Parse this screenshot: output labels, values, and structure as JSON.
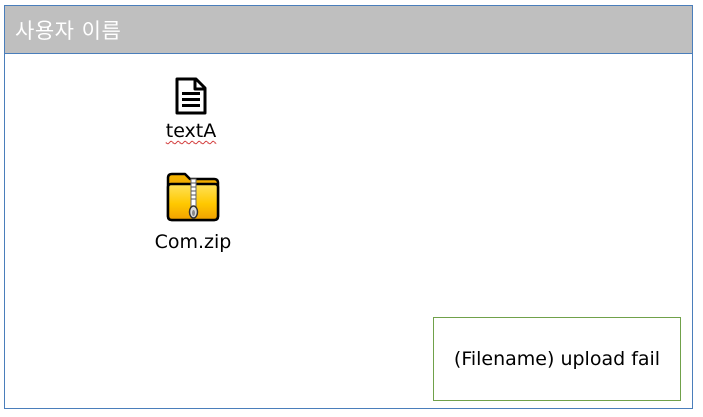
{
  "window": {
    "title": "사용자 이름"
  },
  "files": [
    {
      "name": "textA",
      "icon": "text-document-icon"
    },
    {
      "name": "Com.zip",
      "icon": "zip-folder-icon"
    }
  ],
  "notification": {
    "message": "(Filename) upload fail"
  },
  "colors": {
    "titlebar_bg": "#bfbfbf",
    "window_border": "#4a7ebb",
    "toast_border": "#70a14a",
    "folder_yellow": "#ffcc00",
    "spellcheck_underline": "#d23b3b"
  }
}
